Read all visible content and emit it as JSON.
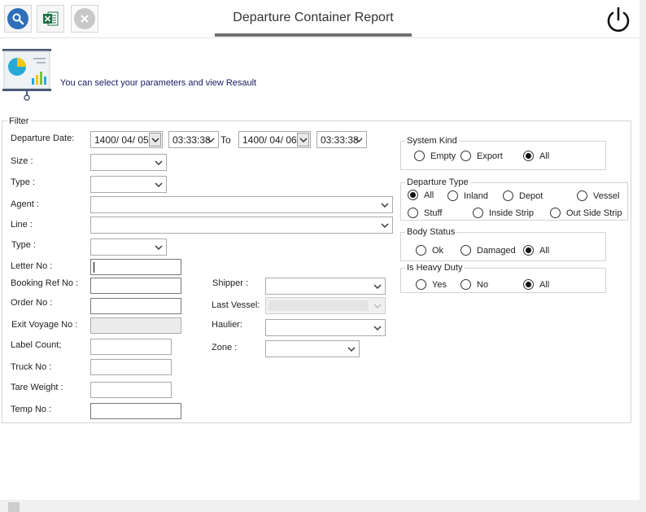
{
  "header": {
    "title": "Departure Container Report",
    "toolbar": {
      "search_icon": "search-icon",
      "excel_icon": "excel-icon",
      "cancel_icon": "close-icon"
    },
    "power_icon": "power-icon",
    "accent_color": "#2f6fba"
  },
  "info": {
    "text": "You can select your parameters  and view Resault",
    "icon": "report-presentation-icon"
  },
  "filter": {
    "legend": "Filter",
    "departure_date_label": "Departure Date:",
    "date_from": "1400/ 04/ 05",
    "time_from": "03:33:38",
    "to_label": "To",
    "date_to": "1400/ 04/ 06",
    "time_to": "03:33:38",
    "size_label": "Size :",
    "type_label": "Type :",
    "agent_label": "Agent :",
    "line_label": "Line :",
    "type2_label": "Type :",
    "letter_no_label": "Letter No :",
    "booking_ref_label": "Booking Ref No :",
    "order_no_label": "Order No :",
    "exit_voyage_label": "Exit Voyage No :",
    "label_count_label": "Label Count;",
    "truck_no_label": "Truck No :",
    "tare_weight_label": "Tare Weight :",
    "temp_no_label": "Temp No :",
    "shipper_label": "Shipper :",
    "last_vessel_label": "Last Vessel:",
    "haulier_label": "Haulier:",
    "zone_label": "Zone :"
  },
  "system_kind": {
    "title": "System Kind",
    "options": [
      {
        "label": "Empty",
        "checked": false
      },
      {
        "label": "Export",
        "checked": false
      },
      {
        "label": "All",
        "checked": true
      }
    ]
  },
  "departure_type": {
    "title": "Departure Type",
    "options": [
      {
        "label": "All",
        "checked": true
      },
      {
        "label": "Inland",
        "checked": false
      },
      {
        "label": "Depot",
        "checked": false
      },
      {
        "label": "Vessel",
        "checked": false
      },
      {
        "label": "Stuff",
        "checked": false
      },
      {
        "label": "Inside Strip",
        "checked": false
      },
      {
        "label": "Out Side Strip",
        "checked": false
      }
    ]
  },
  "body_status": {
    "title": "Body Status",
    "options": [
      {
        "label": "Ok",
        "checked": false
      },
      {
        "label": "Damaged",
        "checked": false
      },
      {
        "label": "All",
        "checked": true
      }
    ]
  },
  "heavy_duty": {
    "title": "Is Heavy Duty",
    "options": [
      {
        "label": "Yes",
        "checked": false
      },
      {
        "label": "No",
        "checked": false
      },
      {
        "label": "All",
        "checked": true
      }
    ]
  }
}
